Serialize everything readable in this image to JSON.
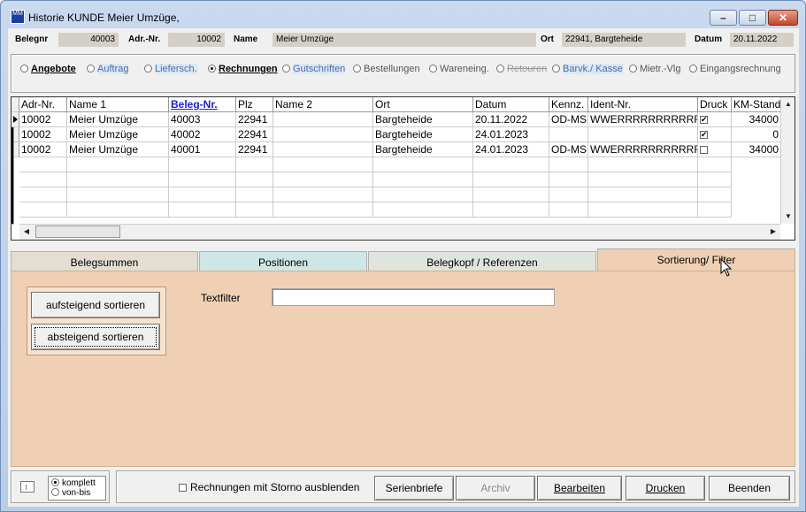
{
  "window": {
    "title": "Historie KUNDE Meier Umzüge,",
    "app_icon_text": "MM",
    "minimize_glyph": "–",
    "maximize_glyph": "□",
    "close_glyph": "✕"
  },
  "header": {
    "belegnr_label": "Belegnr",
    "belegnr_value": "40003",
    "adrnr_label": "Adr.-Nr.",
    "adrnr_value": "10002",
    "name_label": "Name",
    "name_value": "Meier Umzüge",
    "ort_label": "Ort",
    "ort_value": "22941, Bargteheide",
    "datum_label": "Datum",
    "datum_value": "20.11.2022"
  },
  "doc_types": [
    {
      "label": "Angebote",
      "selected": false
    },
    {
      "label": "Auftrag",
      "selected": false
    },
    {
      "label": "Liefersch.",
      "selected": false
    },
    {
      "label": "Rechnungen",
      "selected": true
    },
    {
      "label": "Gutschriften",
      "selected": false
    },
    {
      "label": "Bestellungen",
      "selected": false
    },
    {
      "label": "Wareneing.",
      "selected": false
    },
    {
      "label": "Retouren",
      "selected": false
    },
    {
      "label": "Barvk./ Kasse",
      "selected": false
    },
    {
      "label": "Mietr.-Vlg",
      "selected": false
    },
    {
      "label": "Eingangsrechnung",
      "selected": false
    }
  ],
  "grid": {
    "columns": [
      "Adr-Nr.",
      "Name 1",
      "Beleg-Nr.",
      "Plz",
      "Name 2",
      "Ort",
      "Datum",
      "Kennz.",
      "Ident-Nr.",
      "Druck",
      "KM-Stand"
    ],
    "sorted_column": "Beleg-Nr.",
    "rows": [
      {
        "adrnr": "10002",
        "name1": "Meier Umzüge",
        "belegnr": "40003",
        "plz": "22941",
        "name2": "",
        "ort": "Bargteheide",
        "datum": "20.11.2022",
        "kennz": "OD-MS",
        "ident": "WWERRRRRRRRRRRR",
        "druck": true,
        "km": "34000"
      },
      {
        "adrnr": "10002",
        "name1": "Meier Umzüge",
        "belegnr": "40002",
        "plz": "22941",
        "name2": "",
        "ort": "Bargteheide",
        "datum": "24.01.2023",
        "kennz": "",
        "ident": "",
        "druck": true,
        "km": "0"
      },
      {
        "adrnr": "10002",
        "name1": "Meier Umzüge",
        "belegnr": "40001",
        "plz": "22941",
        "name2": "",
        "ort": "Bargteheide",
        "datum": "24.01.2023",
        "kennz": "OD-MS",
        "ident": "WWERRRRRRRRRRRR",
        "druck": false,
        "km": "34000"
      }
    ]
  },
  "tabs": [
    "Belegsummen",
    "Positionen",
    "Belegkopf / Referenzen",
    "Sortierung/ Filter"
  ],
  "active_tab": "Sortierung/ Filter",
  "sort_panel": {
    "asc_label": "aufsteigend sortieren",
    "desc_label": "absteigend sortieren",
    "textfilter_label": "Textfilter",
    "textfilter_value": ""
  },
  "bottom": {
    "mode_komplett": "komplett",
    "mode_vonbis": "von-bis",
    "storno_checkbox_label": "Rechnungen mit Storno ausblenden",
    "serienbriefe": "Serienbriefe",
    "archiv": "Archiv",
    "bearbeiten": "Bearbeiten",
    "drucken": "Drucken",
    "beenden": "Beenden"
  },
  "colors": {
    "tab_pane": "#f0d0b4",
    "tab_positionen": "#cfe6e6",
    "link_blue": "#1f1fd0"
  }
}
